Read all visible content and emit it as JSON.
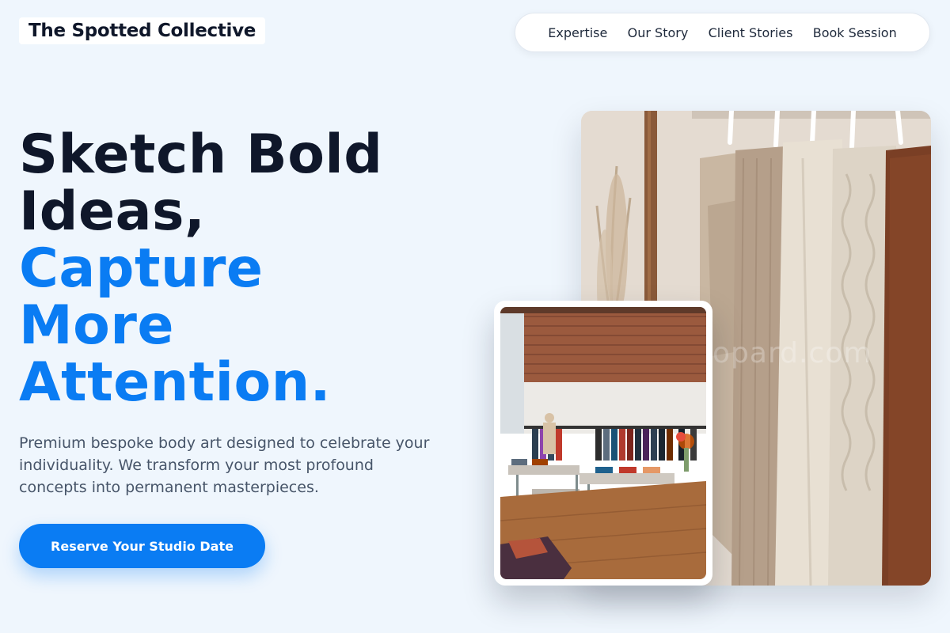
{
  "brand": {
    "name": "The Spotted Collective"
  },
  "nav": {
    "items": [
      {
        "label": "Expertise"
      },
      {
        "label": "Our Story"
      },
      {
        "label": "Client Stories"
      },
      {
        "label": "Book Session"
      }
    ]
  },
  "hero": {
    "headline_line1": "Sketch Bold",
    "headline_line2": "Ideas,",
    "headline_line3": "Capture",
    "headline_line4": "More",
    "headline_line5": "Attention.",
    "description": "Premium bespoke body art designed to celebrate your individuality. We transform your most profound concepts into permanent masterpieces.",
    "cta_label": "Reserve Your Studio Date"
  },
  "images": {
    "main_photo": "clothing-rack-photo",
    "store_photo": "clothing-store-interior-photo",
    "watermark": "opard.com"
  },
  "colors": {
    "background": "#eff6fd",
    "accent": "#0a7cf3",
    "headline_dark": "#0f172a",
    "body_text": "#475569"
  }
}
